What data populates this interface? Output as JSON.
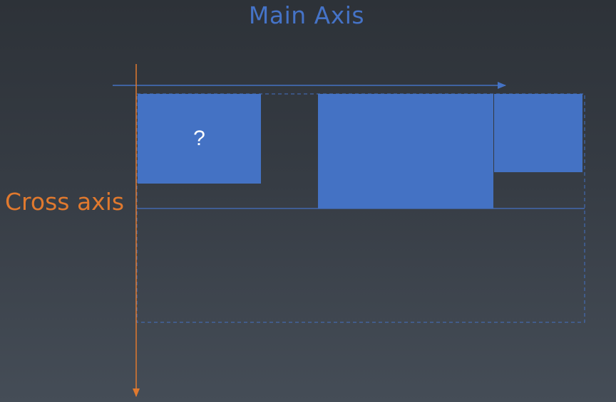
{
  "main_axis": {
    "label": "Main Axis"
  },
  "cross_axis": {
    "label": "Cross axis"
  },
  "items": [
    {
      "label": "?"
    },
    {
      "label": ""
    },
    {
      "label": ""
    }
  ],
  "colors": {
    "item_fill": "#4472c4",
    "main_axis": "#4472c4",
    "cross_axis": "#e0792e",
    "background_top": "#2d3238",
    "background_bottom": "#454d57"
  }
}
